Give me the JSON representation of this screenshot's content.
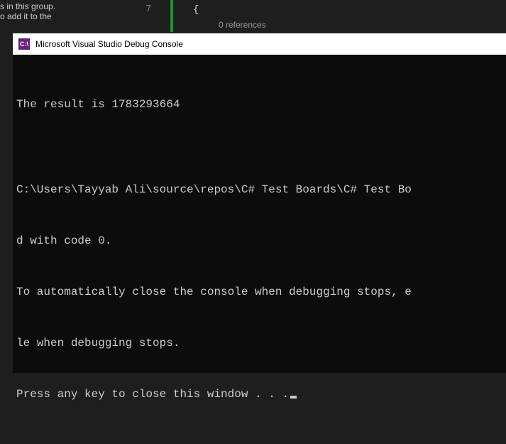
{
  "editor": {
    "partial_text_1": "s in this group.",
    "partial_text_2": "o add it to the",
    "line_number": "7",
    "brace": "{",
    "references": "0 references"
  },
  "console": {
    "icon_text": "C:\\",
    "title": "Microsoft Visual Studio Debug Console",
    "output_line_1": "The result is 1783293664",
    "output_line_2": "",
    "output_line_3": "C:\\Users\\Tayyab Ali\\source\\repos\\C# Test Boards\\C# Test Bo",
    "output_line_4": "d with code 0.",
    "output_line_5": "To automatically close the console when debugging stops, e",
    "output_line_6": "le when debugging stops.",
    "output_line_7": "Press any key to close this window . . ."
  }
}
